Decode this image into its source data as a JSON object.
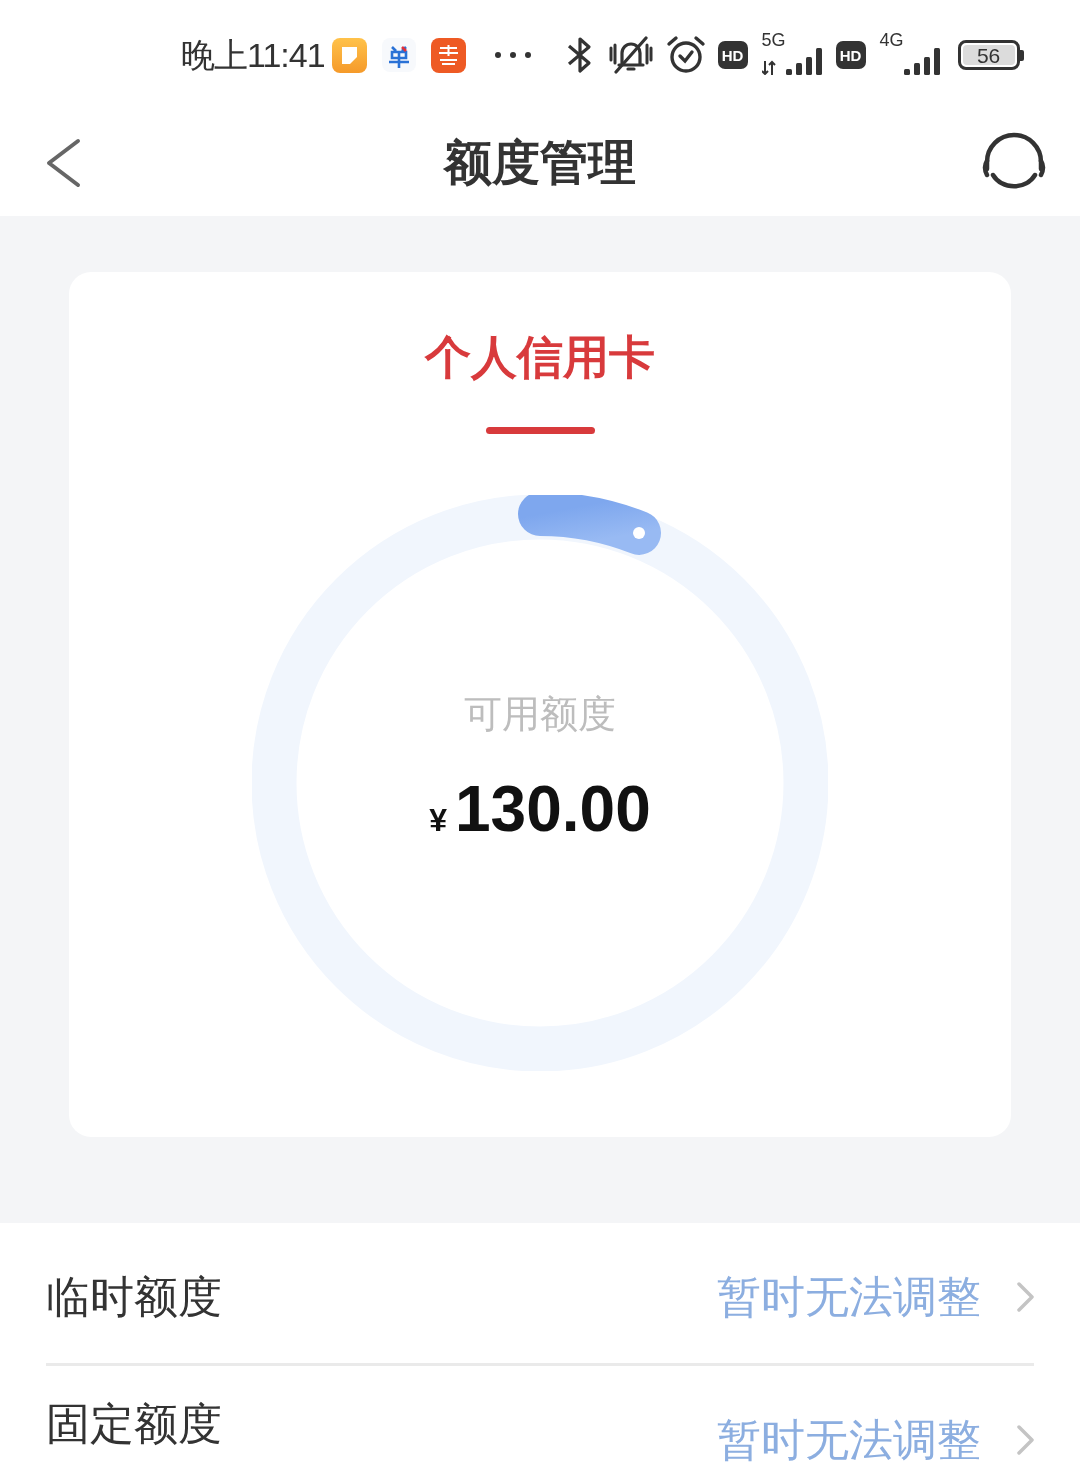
{
  "status_bar": {
    "time": "晚上11:41",
    "networks": [
      {
        "badge": "HD",
        "type": "5G",
        "activity": true
      },
      {
        "badge": "HD",
        "type": "4G",
        "activity": false
      }
    ],
    "battery": "56"
  },
  "header": {
    "title": "额度管理"
  },
  "card": {
    "tabs": [
      {
        "label": "个人信用卡",
        "selected": true
      }
    ],
    "gauge": {
      "level": 0.06,
      "label": "可用额度",
      "currency": "¥",
      "amount": "130.00"
    }
  },
  "limits": [
    {
      "label": "临时额度",
      "value": "暂时无法调整"
    },
    {
      "label": "固定额度",
      "value": "暂时无法调整"
    }
  ]
}
